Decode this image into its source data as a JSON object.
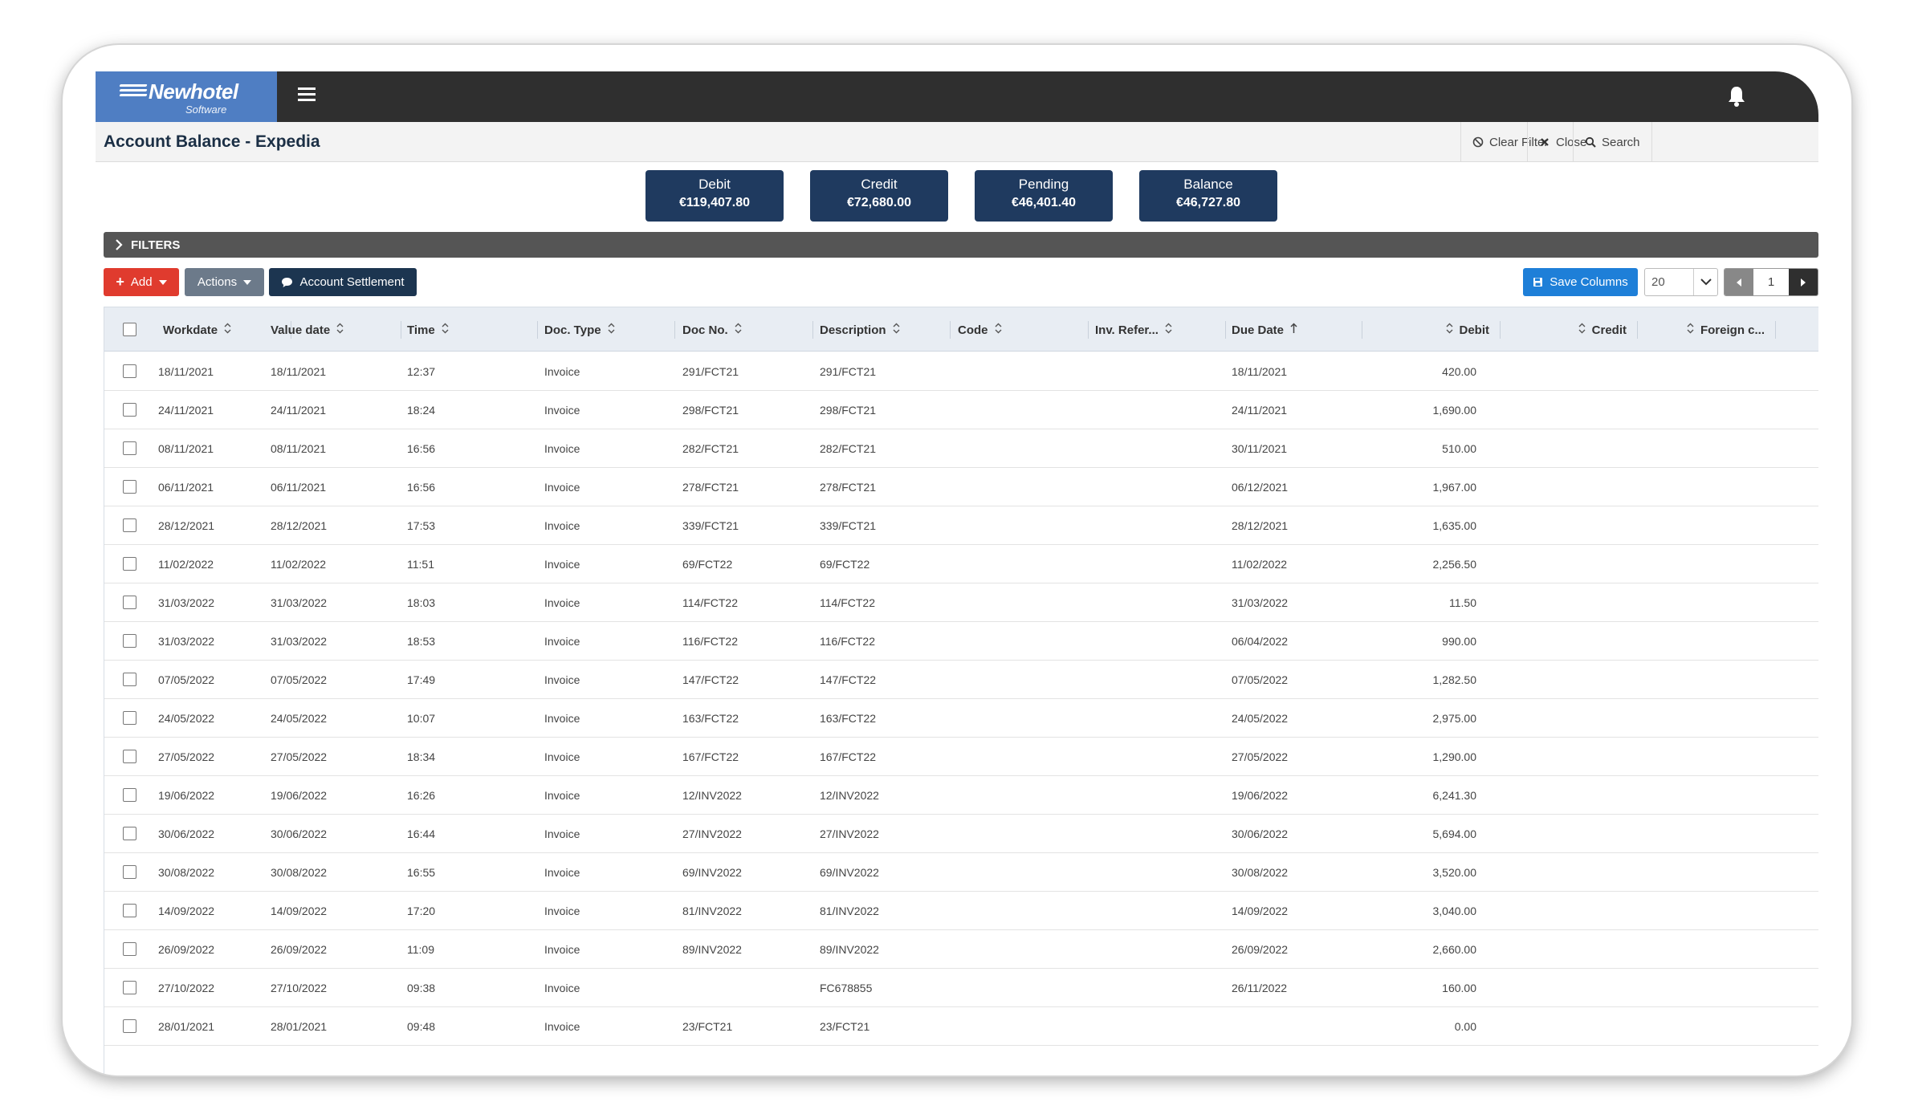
{
  "app": {
    "logo_name": "Newhotel",
    "logo_sub": "Software"
  },
  "header": {
    "title": "Account Balance - Expedia",
    "clear_filter": "Clear Filter",
    "close": "Close",
    "search": "Search"
  },
  "summary": [
    {
      "label": "Debit",
      "value": "€119,407.80"
    },
    {
      "label": "Credit",
      "value": "€72,680.00"
    },
    {
      "label": "Pending",
      "value": "€46,401.40"
    },
    {
      "label": "Balance",
      "value": "€46,727.80"
    }
  ],
  "filters": {
    "label": "FILTERS"
  },
  "toolbar": {
    "add": "Add",
    "actions": "Actions",
    "account_settlement": "Account Settlement",
    "save_columns": "Save Columns",
    "page_size": "20",
    "page": "1"
  },
  "table": {
    "columns": [
      "Workdate",
      "Value date",
      "Time",
      "Doc. Type",
      "Doc No.",
      "Description",
      "Code",
      "Inv. Refer...",
      "Due Date",
      "Debit",
      "Credit",
      "Foreign c...",
      "Foreign c"
    ],
    "rows": [
      [
        "18/11/2021",
        "18/11/2021",
        "12:37",
        "Invoice",
        "291/FCT21",
        "291/FCT21",
        "",
        "",
        "18/11/2021",
        "420.00"
      ],
      [
        "24/11/2021",
        "24/11/2021",
        "18:24",
        "Invoice",
        "298/FCT21",
        "298/FCT21",
        "",
        "",
        "24/11/2021",
        "1,690.00"
      ],
      [
        "08/11/2021",
        "08/11/2021",
        "16:56",
        "Invoice",
        "282/FCT21",
        "282/FCT21",
        "",
        "",
        "30/11/2021",
        "510.00"
      ],
      [
        "06/11/2021",
        "06/11/2021",
        "16:56",
        "Invoice",
        "278/FCT21",
        "278/FCT21",
        "",
        "",
        "06/12/2021",
        "1,967.00"
      ],
      [
        "28/12/2021",
        "28/12/2021",
        "17:53",
        "Invoice",
        "339/FCT21",
        "339/FCT21",
        "",
        "",
        "28/12/2021",
        "1,635.00"
      ],
      [
        "11/02/2022",
        "11/02/2022",
        "11:51",
        "Invoice",
        "69/FCT22",
        "69/FCT22",
        "",
        "",
        "11/02/2022",
        "2,256.50"
      ],
      [
        "31/03/2022",
        "31/03/2022",
        "18:03",
        "Invoice",
        "114/FCT22",
        "114/FCT22",
        "",
        "",
        "31/03/2022",
        "11.50"
      ],
      [
        "31/03/2022",
        "31/03/2022",
        "18:53",
        "Invoice",
        "116/FCT22",
        "116/FCT22",
        "",
        "",
        "06/04/2022",
        "990.00"
      ],
      [
        "07/05/2022",
        "07/05/2022",
        "17:49",
        "Invoice",
        "147/FCT22",
        "147/FCT22",
        "",
        "",
        "07/05/2022",
        "1,282.50"
      ],
      [
        "24/05/2022",
        "24/05/2022",
        "10:07",
        "Invoice",
        "163/FCT22",
        "163/FCT22",
        "",
        "",
        "24/05/2022",
        "2,975.00"
      ],
      [
        "27/05/2022",
        "27/05/2022",
        "18:34",
        "Invoice",
        "167/FCT22",
        "167/FCT22",
        "",
        "",
        "27/05/2022",
        "1,290.00"
      ],
      [
        "19/06/2022",
        "19/06/2022",
        "16:26",
        "Invoice",
        "12/INV2022",
        "12/INV2022",
        "",
        "",
        "19/06/2022",
        "6,241.30"
      ],
      [
        "30/06/2022",
        "30/06/2022",
        "16:44",
        "Invoice",
        "27/INV2022",
        "27/INV2022",
        "",
        "",
        "30/06/2022",
        "5,694.00"
      ],
      [
        "30/08/2022",
        "30/08/2022",
        "16:55",
        "Invoice",
        "69/INV2022",
        "69/INV2022",
        "",
        "",
        "30/08/2022",
        "3,520.00"
      ],
      [
        "14/09/2022",
        "14/09/2022",
        "17:20",
        "Invoice",
        "81/INV2022",
        "81/INV2022",
        "",
        "",
        "14/09/2022",
        "3,040.00"
      ],
      [
        "26/09/2022",
        "26/09/2022",
        "11:09",
        "Invoice",
        "89/INV2022",
        "89/INV2022",
        "",
        "",
        "26/09/2022",
        "2,660.00"
      ],
      [
        "27/10/2022",
        "27/10/2022",
        "09:38",
        "Invoice",
        "",
        "FC678855",
        "",
        "",
        "26/11/2022",
        "160.00"
      ],
      [
        "28/01/2021",
        "28/01/2021",
        "09:48",
        "Invoice",
        "23/FCT21",
        "23/FCT21",
        "",
        "",
        "",
        "0.00"
      ]
    ]
  },
  "colors": {
    "topbar": "#2f2f2f",
    "logo_bg": "#4f7ec3",
    "card_bg": "#1f3a5f",
    "add_button": "#e03b2e",
    "save_button": "#1e7fd8"
  }
}
